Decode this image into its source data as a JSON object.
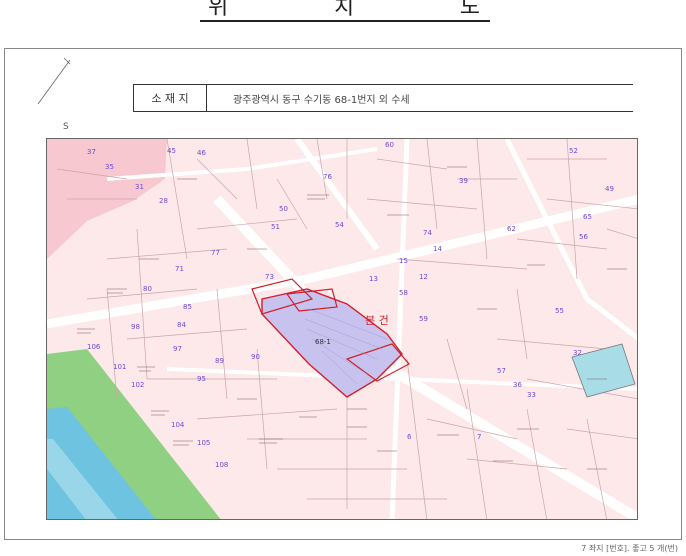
{
  "page": {
    "title_chars": [
      "위",
      "치",
      "도"
    ],
    "address_label": "소 재 지",
    "address_value": "광주광역시 동구 수기동 68-1번지 외 수세",
    "north_mark": "S",
    "footer": "7 좌지 [번호]. 좋고 5 개(번)"
  },
  "map": {
    "site_label": "본 건",
    "site_lot": "68-1",
    "colors": {
      "background": "#fde8ea",
      "block_lines": "#c9a5aa",
      "road": "#ffffff",
      "river": "#6ec3e0",
      "riverbank": "#8fd083",
      "park": "#f7c8cf",
      "site_fill": "#c8c3ee",
      "site_border": "#d11f2a",
      "lot_text": "#6b4bd0"
    },
    "lot_numbers": [
      {
        "text": "37"
      },
      {
        "text": "35"
      },
      {
        "text": "45"
      },
      {
        "text": "46"
      },
      {
        "text": "31"
      },
      {
        "text": "28"
      },
      {
        "text": "60"
      },
      {
        "text": "76"
      },
      {
        "text": "52"
      },
      {
        "text": "49"
      },
      {
        "text": "54"
      },
      {
        "text": "51"
      },
      {
        "text": "50"
      },
      {
        "text": "74"
      },
      {
        "text": "62"
      },
      {
        "text": "56"
      },
      {
        "text": "77"
      },
      {
        "text": "73"
      },
      {
        "text": "71"
      },
      {
        "text": "80"
      },
      {
        "text": "85"
      },
      {
        "text": "84"
      },
      {
        "text": "98"
      },
      {
        "text": "97"
      },
      {
        "text": "89"
      },
      {
        "text": "90"
      },
      {
        "text": "95"
      },
      {
        "text": "101"
      },
      {
        "text": "102"
      },
      {
        "text": "106"
      },
      {
        "text": "104"
      },
      {
        "text": "105"
      },
      {
        "text": "108"
      },
      {
        "text": "55"
      },
      {
        "text": "32"
      },
      {
        "text": "57"
      },
      {
        "text": "58"
      },
      {
        "text": "59"
      },
      {
        "text": "15"
      },
      {
        "text": "13"
      },
      {
        "text": "12"
      },
      {
        "text": "39"
      },
      {
        "text": "65"
      },
      {
        "text": "14"
      },
      {
        "text": "36"
      },
      {
        "text": "33"
      },
      {
        "text": "6"
      },
      {
        "text": "7"
      }
    ]
  }
}
